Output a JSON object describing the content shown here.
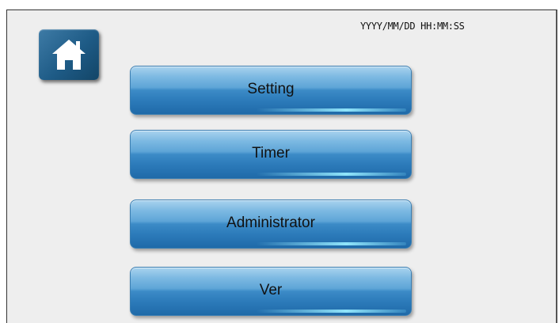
{
  "header": {
    "datetime": "YYYY/MM/DD HH:MM:SS"
  },
  "home": {
    "icon": "home-icon"
  },
  "menu": {
    "items": [
      {
        "label": "Setting"
      },
      {
        "label": "Timer"
      },
      {
        "label": "Administrator"
      },
      {
        "label": "Ver"
      }
    ]
  },
  "colors": {
    "button_blue": "#3c8bc7",
    "home_blue": "#1e5b86",
    "background": "#eeeeee"
  }
}
